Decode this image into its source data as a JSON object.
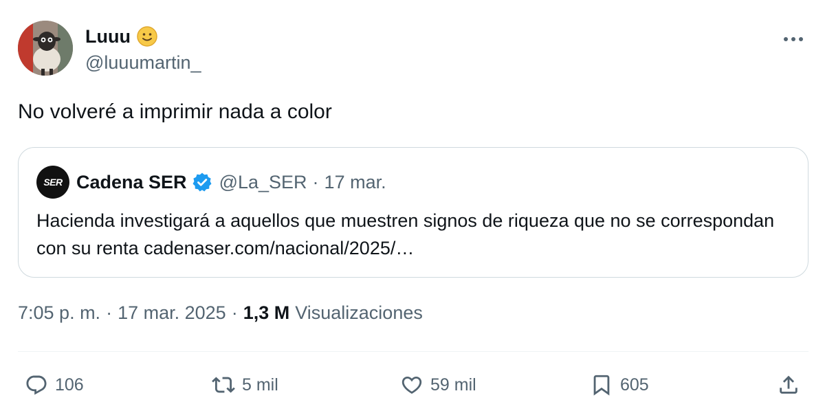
{
  "author": {
    "name": "Luuu",
    "handle": "@luuumartin_"
  },
  "tweet": {
    "text": "No volveré a imprimir nada a color"
  },
  "quoted": {
    "logo_text": "SER",
    "name": "Cadena SER",
    "handle": "@La_SER",
    "separator": "·",
    "date": "17 mar.",
    "text": "Hacienda investigará a aquellos que muestren signos de riqueza que no se correspondan con su renta cadenaser.com/nacional/2025/…"
  },
  "meta": {
    "time": "7:05 p. m.",
    "separator": "·",
    "date": "17 mar. 2025",
    "separator2": "·",
    "views_count": "1,3 M",
    "views_label": "Visualizaciones"
  },
  "actions": {
    "replies": "106",
    "reposts": "5 mil",
    "likes": "59 mil",
    "bookmarks": "605"
  },
  "colors": {
    "text": "#0f1419",
    "secondary": "#536471",
    "border": "#cfd9de",
    "verified": "#1d9bf0"
  }
}
